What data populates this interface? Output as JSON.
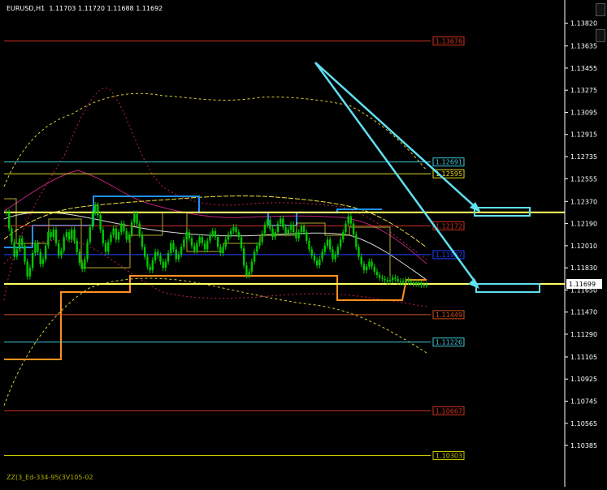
{
  "header": {
    "symbol_timeframe": "EURUSD,H1",
    "ohlc": "1.11703 1.11720 1.11688 1.11692"
  },
  "footer": {
    "indicator_label": "ZZ(3_Ed-334-95(3V105-02"
  },
  "colors": {
    "background": "#000000",
    "axis_text": "#ffffff",
    "candles": "#00c800",
    "current_price_box": "#ffffff"
  },
  "chart_data": {
    "type": "line",
    "title": "",
    "xlabel": "",
    "ylabel": "",
    "ylim": [
      1.1026,
      1.1391
    ],
    "y_tick_labels": [
      "1.13820",
      "1.13635",
      "1.13455",
      "1.13275",
      "1.13095",
      "1.12915",
      "1.12735",
      "1.12555",
      "1.12370",
      "1.12190",
      "1.12010",
      "1.11830",
      "1.11650",
      "1.11470",
      "1.11290",
      "1.11105",
      "1.10925",
      "1.10745",
      "1.10565",
      "1.10385"
    ],
    "current_price": {
      "value": 1.11699,
      "label": "1.11699"
    },
    "horizontal_levels": [
      {
        "label": "1.13676",
        "value": 1.13676,
        "color": "#d03020"
      },
      {
        "label": "1.12691",
        "value": 1.12691,
        "color": "#40c8d8"
      },
      {
        "label": "1.12595",
        "value": 1.12595,
        "color": "#e8d820"
      },
      {
        "label": "",
        "value": 1.12281,
        "color": "#ffff60"
      },
      {
        "label": "1.12172",
        "value": 1.12172,
        "color": "#d03020"
      },
      {
        "label": "1.11937",
        "value": 1.11937,
        "color": "#2040ff"
      },
      {
        "label": "1.11449",
        "value": 1.11449,
        "color": "#d05020"
      },
      {
        "label": "1.11226",
        "value": 1.11226,
        "color": "#40c8d8"
      },
      {
        "label": "1.10667",
        "value": 1.10667,
        "color": "#d03020"
      },
      {
        "label": "1.10303",
        "value": 1.10303,
        "color": "#c8c800"
      }
    ],
    "price_series": {
      "name": "",
      "x": [
        0,
        1,
        2,
        3,
        4,
        5,
        6,
        7,
        8,
        9,
        10,
        11,
        12,
        13,
        14,
        15,
        16,
        17,
        18,
        19,
        20,
        21,
        22,
        23,
        24,
        25,
        26,
        27,
        28,
        29,
        30,
        31,
        32,
        33,
        34,
        35,
        36,
        37,
        38,
        39,
        40,
        41,
        42,
        43,
        44,
        45,
        46,
        47,
        48,
        49,
        50,
        51,
        52,
        53,
        54,
        55,
        56,
        57,
        58,
        59,
        60,
        61,
        62,
        63,
        64,
        65,
        66,
        67,
        68,
        69,
        70,
        71,
        72,
        73,
        74,
        75,
        76,
        77,
        78,
        79,
        80,
        81,
        82,
        83,
        84,
        85,
        86,
        87,
        88,
        89,
        90,
        91,
        92,
        93,
        94,
        95,
        96,
        97,
        98,
        99,
        100,
        101,
        102,
        103,
        104,
        105,
        106,
        107,
        108,
        109,
        110,
        111,
        112,
        113,
        114,
        115,
        116,
        117,
        118,
        119,
        120,
        121,
        122,
        123,
        124,
        125,
        126,
        127,
        128,
        129,
        130,
        131,
        132,
        133,
        134,
        135,
        136,
        137,
        138,
        139,
        140,
        141,
        142,
        143,
        144,
        145,
        146,
        147,
        148,
        149,
        150,
        151,
        152,
        153,
        154,
        155,
        156,
        157,
        158,
        159
      ],
      "values": [
        1.1228,
        1.1215,
        1.1204,
        1.1192,
        1.1198,
        1.1207,
        1.1201,
        1.1188,
        1.1176,
        1.1183,
        1.1195,
        1.1203,
        1.1196,
        1.1186,
        1.119,
        1.1201,
        1.1212,
        1.1208,
        1.1214,
        1.1203,
        1.1193,
        1.1197,
        1.1208,
        1.1212,
        1.1206,
        1.1214,
        1.1205,
        1.1196,
        1.1187,
        1.1182,
        1.119,
        1.1204,
        1.1216,
        1.1228,
        1.1234,
        1.1226,
        1.1214,
        1.1203,
        1.1196,
        1.1204,
        1.121,
        1.1215,
        1.1206,
        1.1212,
        1.1219,
        1.1213,
        1.1206,
        1.121,
        1.122,
        1.1227,
        1.1219,
        1.121,
        1.12,
        1.1192,
        1.1184,
        1.1181,
        1.1189,
        1.1196,
        1.1193,
        1.1188,
        1.1183,
        1.1188,
        1.1195,
        1.1203,
        1.1198,
        1.119,
        1.1194,
        1.12,
        1.1206,
        1.1212,
        1.1207,
        1.1201,
        1.1197,
        1.1203,
        1.1208,
        1.1203,
        1.1198,
        1.1205,
        1.121,
        1.1213,
        1.1208,
        1.12,
        1.1195,
        1.12,
        1.1206,
        1.121,
        1.1213,
        1.1216,
        1.1212,
        1.1208,
        1.1199,
        1.1185,
        1.1177,
        1.118,
        1.1188,
        1.1196,
        1.1201,
        1.1204,
        1.1211,
        1.1218,
        1.1222,
        1.1215,
        1.1208,
        1.1212,
        1.1219,
        1.1223,
        1.1216,
        1.1211,
        1.1214,
        1.1218,
        1.1212,
        1.1207,
        1.1212,
        1.1217,
        1.1212,
        1.1205,
        1.1198,
        1.1193,
        1.1189,
        1.1185,
        1.119,
        1.1196,
        1.1201,
        1.1206,
        1.1198,
        1.119,
        1.1194,
        1.12,
        1.1206,
        1.1212,
        1.1219,
        1.1225,
        1.1219,
        1.121,
        1.12,
        1.1192,
        1.1186,
        1.1181,
        1.1184,
        1.1188,
        1.1184,
        1.118,
        1.1177,
        1.1175,
        1.1174,
        1.1173,
        1.1172,
        1.1173,
        1.1175,
        1.1174,
        1.1172,
        1.1171,
        1.1172,
        1.1173,
        1.1172,
        1.1171,
        1.117,
        1.1171,
        1.117,
        1.11692,
        1.11692,
        1.11692
      ]
    }
  }
}
